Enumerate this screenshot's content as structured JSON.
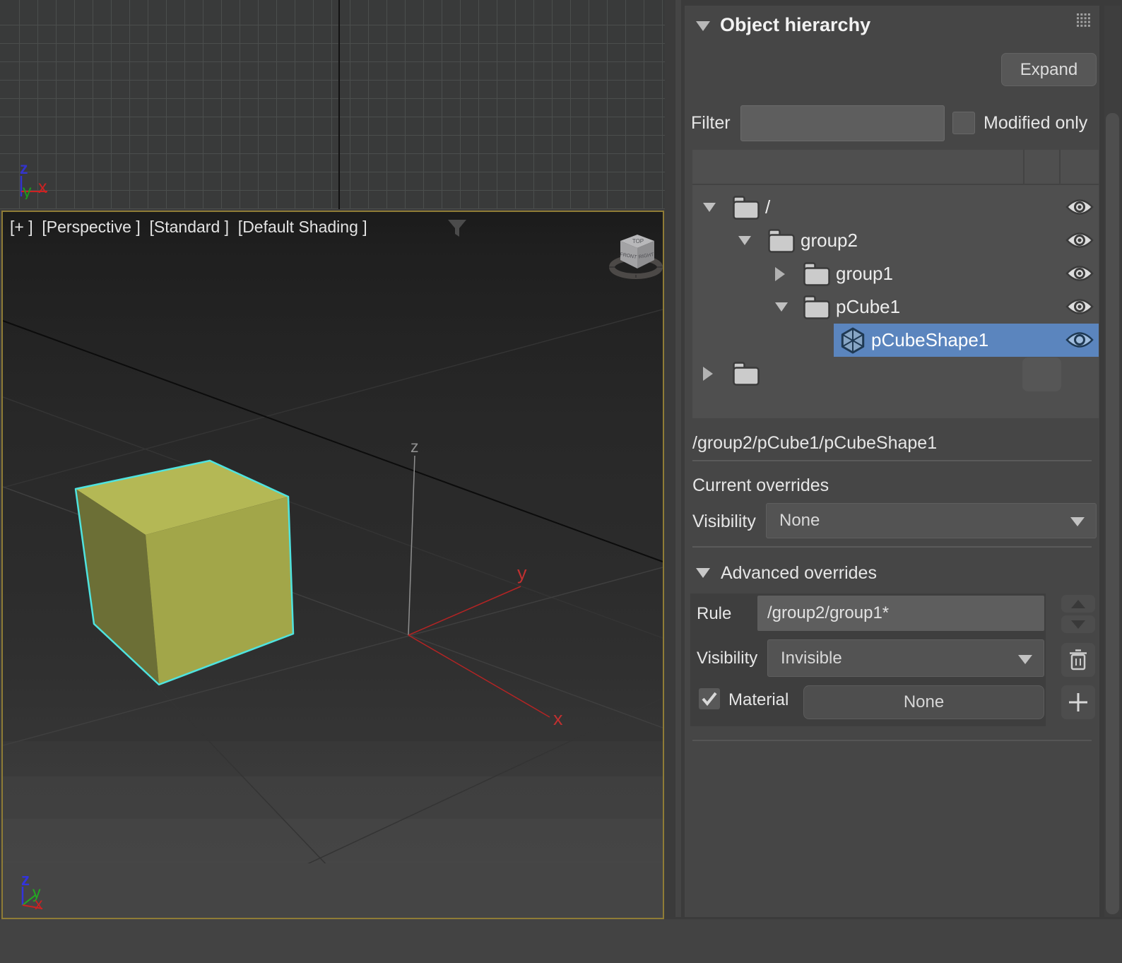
{
  "viewport": {
    "header": "[+ ]  [Perspective ]  [Standard ]  [Default Shading ]",
    "axis": {
      "x": "x",
      "y": "y",
      "z": "z"
    },
    "view_cube": {
      "top": "TOP",
      "front": "FRONT",
      "right": "RIGHT"
    }
  },
  "panel": {
    "title": "Object hierarchy",
    "expand_button": "Expand",
    "filter": {
      "label": "Filter",
      "value": "",
      "modified_only": "Modified only"
    },
    "tree": {
      "rows": [
        {
          "label": "/"
        },
        {
          "label": "group2"
        },
        {
          "label": "group1"
        },
        {
          "label": "pCube1"
        },
        {
          "label": "pCubeShape1"
        },
        {
          "label": ""
        }
      ]
    },
    "selected_path": "/group2/pCube1/pCubeShape1",
    "current_overrides": {
      "heading": "Current overrides",
      "visibility_label": "Visibility",
      "visibility_value": "None"
    },
    "advanced_overrides": {
      "heading": "Advanced overrides",
      "rule_label": "Rule",
      "rule_value": "/group2/group1*",
      "visibility_label": "Visibility",
      "visibility_value": "Invisible",
      "material_label": "Material",
      "material_value": "None"
    },
    "colors": {
      "selection": "#5b85be",
      "viewport_border": "#8f7c36"
    }
  }
}
